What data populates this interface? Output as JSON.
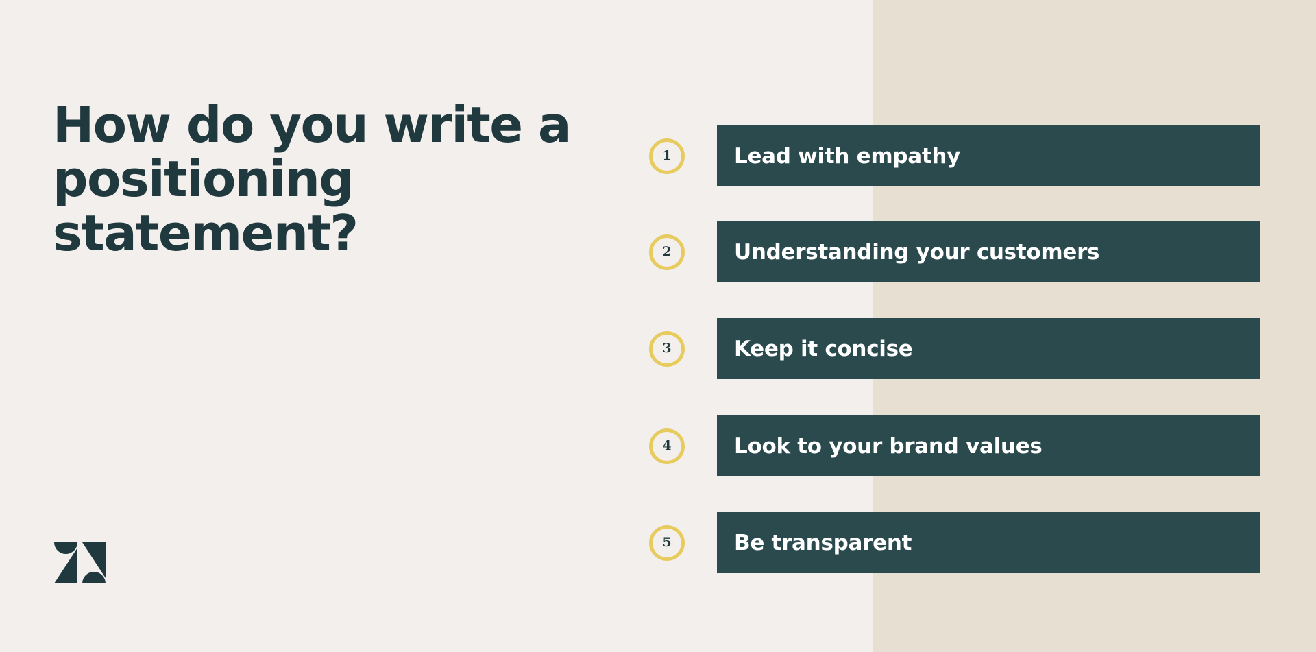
{
  "theme": {
    "bg_left": "#F3EFEC",
    "bg_right": "#E7DFD1",
    "bar_color": "#2A4A4D",
    "badge_ring_color": "#E8CB5E",
    "heading_color": "#20393F",
    "bar_text_color": "#FFFFFF",
    "split_position": "66.35%"
  },
  "heading": {
    "text": "How do you write a\npositioning\nstatement?"
  },
  "brand": {
    "logo_name": "zendesk-logo"
  },
  "steps": [
    {
      "number": "1",
      "label": "Lead with empathy"
    },
    {
      "number": "2",
      "label": "Understanding your customers"
    },
    {
      "number": "3",
      "label": "Keep it concise"
    },
    {
      "number": "4",
      "label": "Look to your brand values"
    },
    {
      "number": "5",
      "label": "Be transparent"
    }
  ]
}
